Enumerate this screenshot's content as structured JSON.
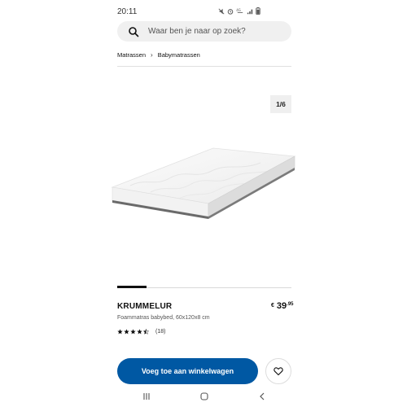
{
  "status_bar": {
    "time": "20:11",
    "icons": [
      "mute-icon",
      "alarm-icon",
      "data-icon",
      "signal-icon",
      "battery-icon"
    ]
  },
  "search": {
    "placeholder": "Waar ben je naar op zoek?"
  },
  "breadcrumb": {
    "items": [
      "Matrassen",
      "Babymatrassen"
    ]
  },
  "gallery": {
    "counter": "1/6",
    "current_index": 1,
    "total": 6
  },
  "product": {
    "name": "KRUMMELUR",
    "description": "Foammatras babybed, 60x120x8 cm",
    "price": {
      "currency": "€",
      "main": "39",
      "decimals": ".95"
    },
    "rating": {
      "stars": 4.5,
      "count": "(18)"
    }
  },
  "actions": {
    "add_to_cart": "Voeg toe aan winkelwagen",
    "favorite_icon": "heart-icon"
  },
  "nav": {
    "icons": [
      "recent-apps-icon",
      "home-icon",
      "back-icon"
    ]
  },
  "colors": {
    "primary_button": "#0058a3",
    "search_bg": "#f0f0f0"
  }
}
